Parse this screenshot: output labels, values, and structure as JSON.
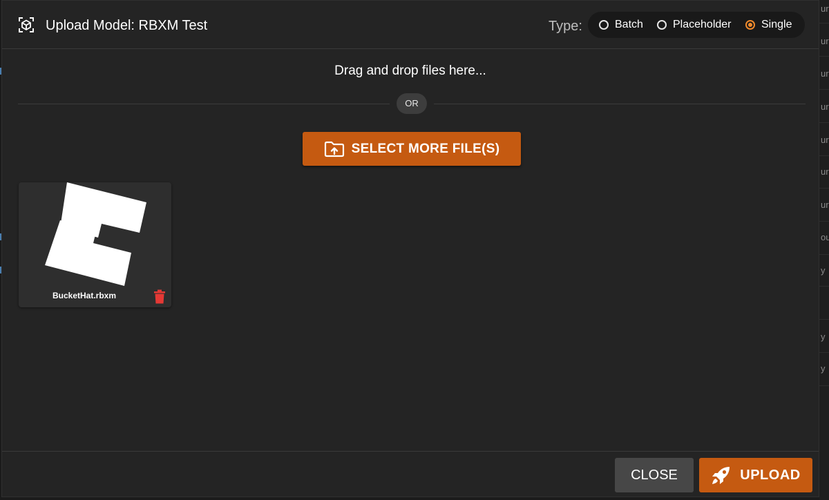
{
  "dialog": {
    "title": "Upload Model: RBXM Test",
    "type_label": "Type:",
    "type_options": [
      {
        "label": "Batch",
        "checked": false
      },
      {
        "label": "Placeholder",
        "checked": false
      },
      {
        "label": "Single",
        "checked": true
      }
    ]
  },
  "dropzone": {
    "instruction": "Drag and drop files here...",
    "or_label": "OR",
    "select_button": "SELECT MORE FILE(S)"
  },
  "files": [
    {
      "name": "BucketHat.rbxm",
      "thumbnail_icon": "roblox-logo-icon"
    }
  ],
  "footer": {
    "close_label": "CLOSE",
    "upload_label": "UPLOAD"
  },
  "background": {
    "right_edge_fragments": [
      "ur",
      "ur",
      "ur",
      "ur",
      "ur",
      "ur",
      "ur",
      "ou",
      "y",
      "y",
      "y"
    ]
  },
  "colors": {
    "accent": "#c55a11",
    "radio_accent": "#f08a2c",
    "delete": "#e53935",
    "dialog_bg": "#242424"
  }
}
